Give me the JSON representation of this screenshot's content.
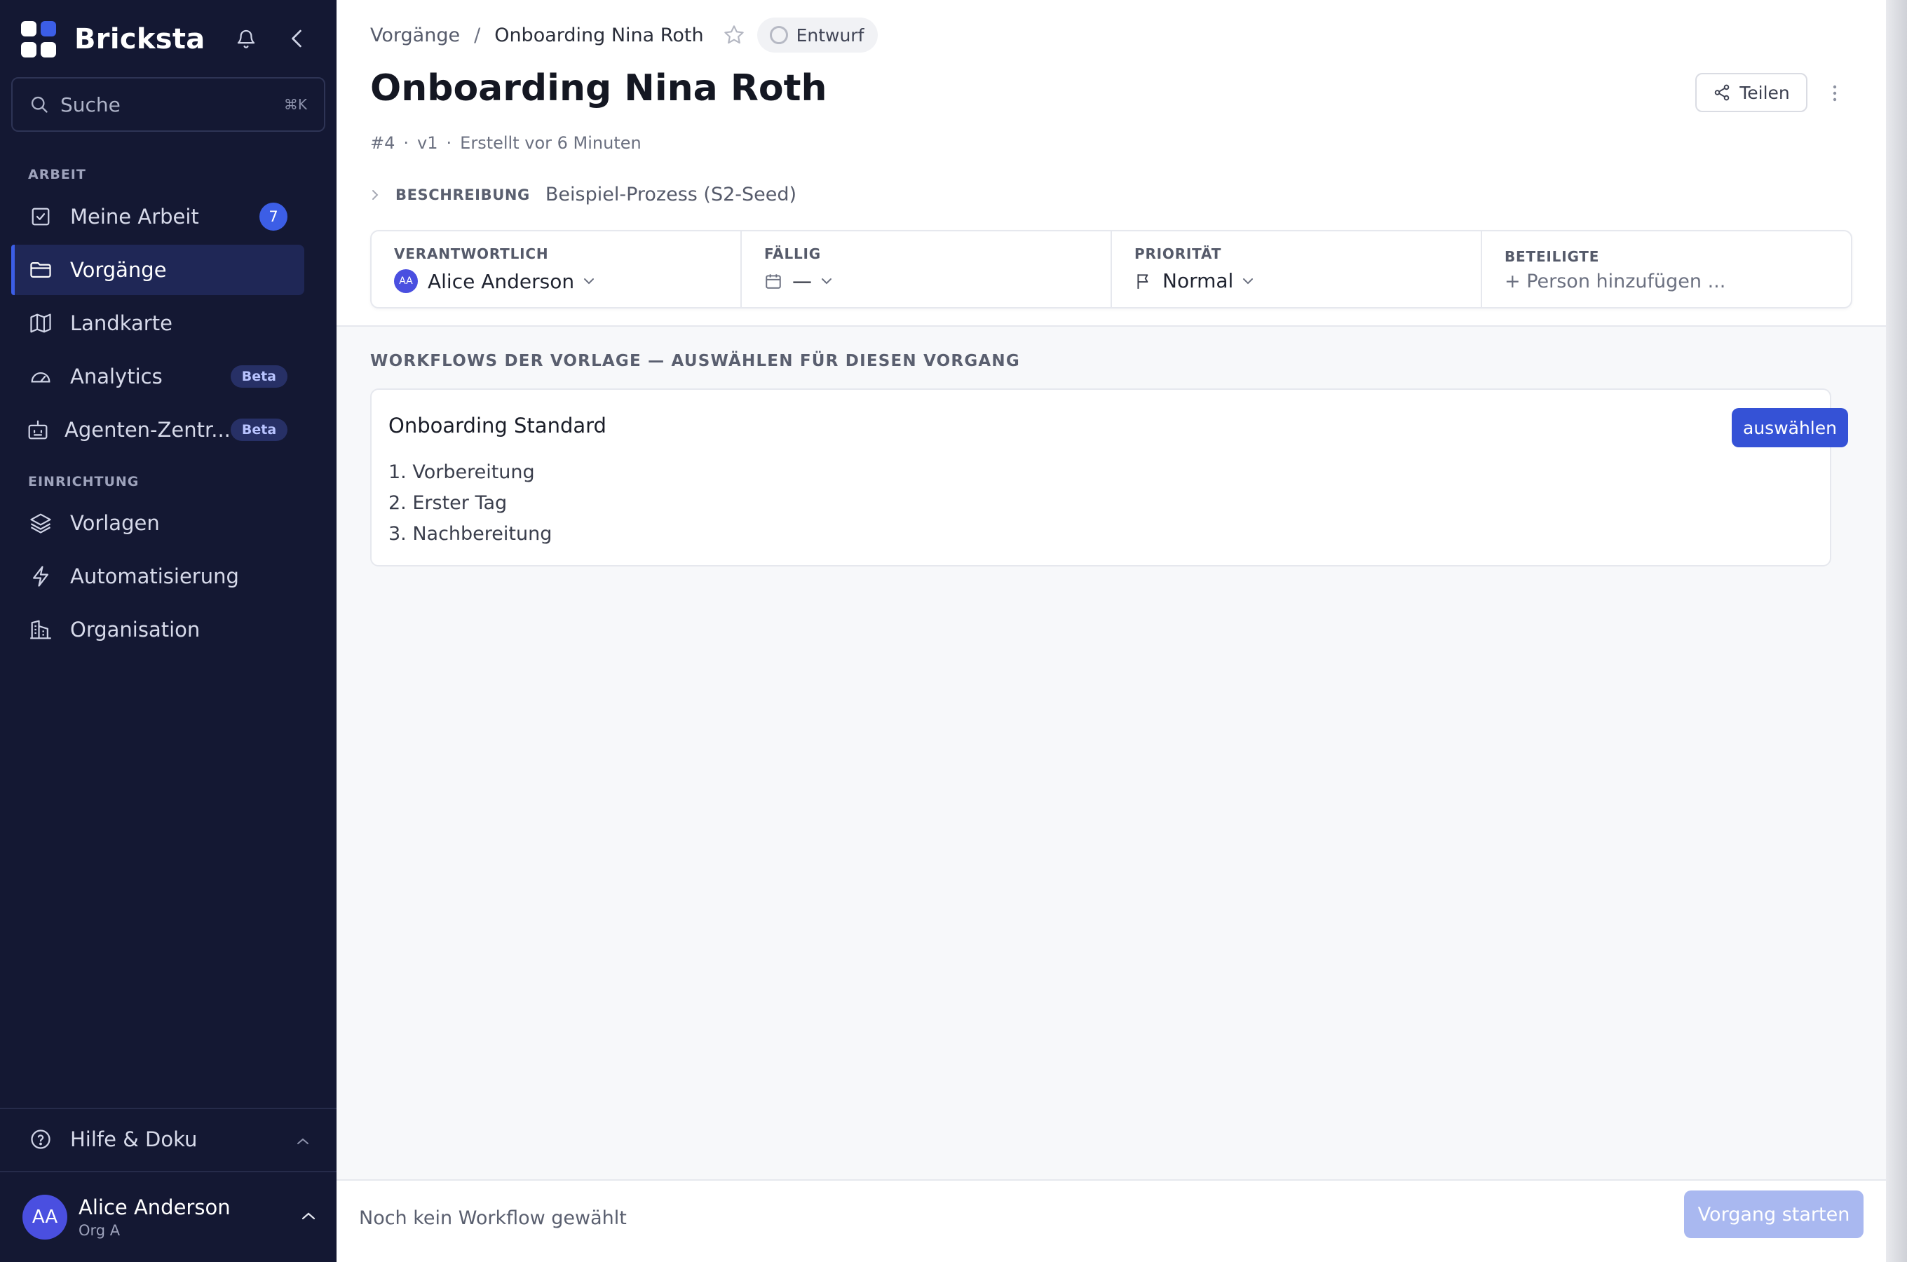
{
  "app": {
    "name": "Bricksta"
  },
  "sidebar": {
    "search": {
      "placeholder": "Suche",
      "shortcut": "⌘K"
    },
    "sections": [
      {
        "label": "ARBEIT"
      },
      {
        "label": "EINRICHTUNG"
      }
    ],
    "items": [
      {
        "label": "Meine Arbeit",
        "icon": "checkbox-icon",
        "badge": "7"
      },
      {
        "label": "Vorgänge",
        "icon": "folder-icon",
        "active": true
      },
      {
        "label": "Landkarte",
        "icon": "map-icon"
      },
      {
        "label": "Analytics",
        "icon": "gauge-icon",
        "badge": "Beta"
      },
      {
        "label": "Agenten-Zentr...",
        "icon": "robot-icon",
        "badge": "Beta"
      },
      {
        "label": "Vorlagen",
        "icon": "layers-icon"
      },
      {
        "label": "Automatisierung",
        "icon": "lightning-icon"
      },
      {
        "label": "Organisation",
        "icon": "building-icon"
      }
    ],
    "help": {
      "label": "Hilfe & Doku"
    },
    "user": {
      "initials": "AA",
      "name": "Alice Anderson",
      "org": "Org A"
    }
  },
  "header": {
    "breadcrumb": [
      "Vorgänge",
      "/",
      "Onboarding Nina Roth"
    ],
    "status": "Entwurf",
    "title": "Onboarding Nina Roth",
    "share_label": "Teilen",
    "meta": {
      "id": "#4",
      "version": "v1",
      "created": "Erstellt vor 6 Minuten",
      "separator": "·"
    },
    "description": {
      "key": "BESCHREIBUNG",
      "value": "Beispiel-Prozess (S2-Seed)"
    }
  },
  "properties": {
    "owner": {
      "label": "VERANTWORTLICH",
      "initials": "AA",
      "value": "Alice Anderson"
    },
    "due": {
      "label": "FÄLLIG",
      "value": "—"
    },
    "priority": {
      "label": "PRIORITÄT",
      "value": "Normal"
    },
    "participants": {
      "label": "BETEILIGTE",
      "value": "+ Person hinzufügen ..."
    }
  },
  "workflows": {
    "heading": "WORKFLOWS DER VORLAGE — AUSWÄHLEN FÜR DIESEN VORGANG",
    "cards": [
      {
        "name": "Onboarding Standard",
        "select_label": "auswählen",
        "steps": [
          "1. Vorbereitung",
          "2. Erster Tag",
          "3. Nachbereitung"
        ]
      }
    ]
  },
  "footer": {
    "message": "Noch kein Workflow gewählt",
    "start_label": "Vorgang starten"
  },
  "colors": {
    "sidebar_bg": "#141833",
    "accent": "#3552d6",
    "accent_disabled": "#a9b8f0",
    "badge": "#3c5ee6"
  }
}
